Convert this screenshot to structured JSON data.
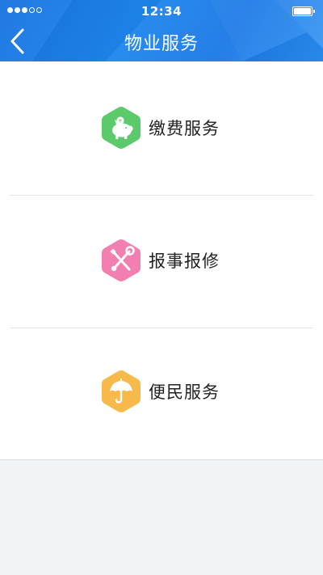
{
  "status_bar": {
    "time": "12:34",
    "signal_filled": 3,
    "signal_total": 5
  },
  "nav": {
    "title": "物业服务",
    "back_icon": "chevron-left-icon"
  },
  "menu": {
    "items": [
      {
        "label": "缴费服务",
        "icon": "piggy-bank-icon",
        "color": "#5cc96a"
      },
      {
        "label": "报事报修",
        "icon": "tools-icon",
        "color": "#f27fb0"
      },
      {
        "label": "便民服务",
        "icon": "umbrella-icon",
        "color": "#f7b94a"
      }
    ]
  },
  "colors": {
    "header": "#1d86ee",
    "background": "#f2f3f5",
    "surface": "#ffffff"
  }
}
